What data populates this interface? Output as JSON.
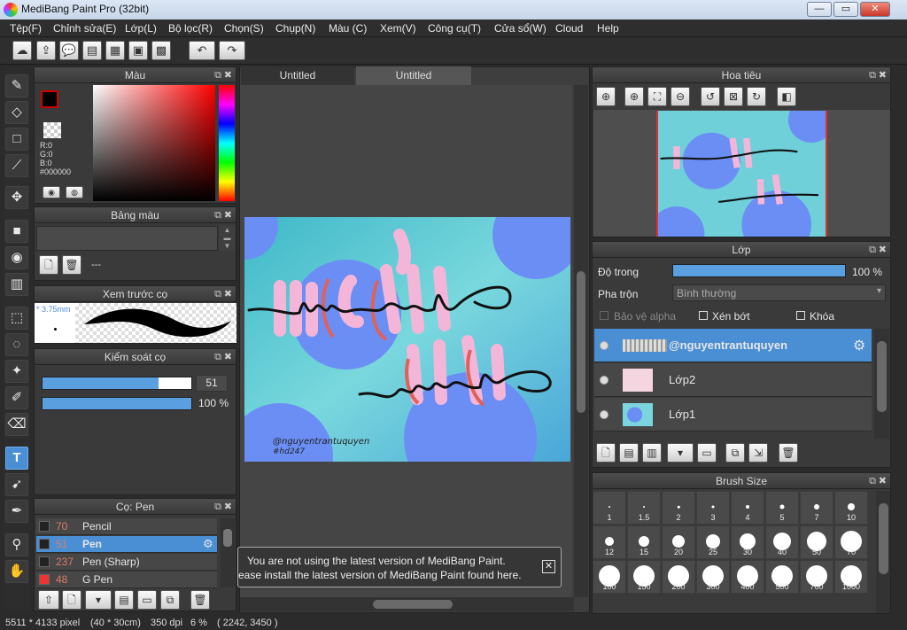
{
  "window": {
    "title": "MediBang Paint Pro (32bit)",
    "min": "—",
    "max": "▭",
    "close": "✕"
  },
  "menu": [
    "Tệp(F)",
    "Chỉnh sửa(E)",
    "Lớp(L)",
    "Bộ lọc(R)",
    "Chọn(S)",
    "Chụp(N)",
    "Màu (C)",
    "Xem(V)",
    "Công cụ(T)",
    "Cửa sổ(W)",
    "Cloud",
    "Help"
  ],
  "color_panel": {
    "title": "Màu",
    "r": "R:0",
    "g": "G:0",
    "b": "B:0",
    "hex": "#000000",
    "fg": "#000000",
    "accent": "#cc0000"
  },
  "palette_panel": {
    "title": "Bảng màu",
    "name": "---"
  },
  "brush_preview": {
    "title": "Xem trước cọ",
    "size": "3.75mm"
  },
  "brush_control": {
    "title": "Kiểm soát cọ",
    "size_value": "51",
    "opacity_value": "100 %",
    "size_fraction": 0.78,
    "opacity_fraction": 1.0
  },
  "brush_list": {
    "title": "Cọ: Pen",
    "items": [
      {
        "num": "70",
        "name": "Pencil",
        "sel": false
      },
      {
        "num": "51",
        "name": "Pen",
        "sel": true
      },
      {
        "num": "237",
        "name": "Pen (Sharp)",
        "sel": false
      },
      {
        "num": "48",
        "name": "G Pen",
        "sel": false
      }
    ]
  },
  "tabs": [
    "Untitled",
    "Untitled"
  ],
  "artwork": {
    "credit1": "@nguyentrantuquyen",
    "credit2": "#hd247"
  },
  "notice": {
    "line1": "You are not using the latest version of MediBang Paint.",
    "line2": "ease install the latest version of MediBang Paint found here."
  },
  "navigator": {
    "title": "Hoa tiêu"
  },
  "layers_panel": {
    "title": "Lớp",
    "opacity_label": "Độ trong",
    "opacity_value": "100 %",
    "opacity_fraction": 1.0,
    "blend_label": "Pha trộn",
    "blend_value": "Bình thường",
    "protect_alpha": "Bảo vệ alpha",
    "clipping": "Xén bớt",
    "lock": "Khóa",
    "layers": [
      {
        "name": "@nguyentrantuquyen",
        "sel": true
      },
      {
        "name": "Lớp2",
        "sel": false
      },
      {
        "name": "Lớp1",
        "sel": false
      }
    ]
  },
  "brush_size": {
    "title": "Brush Size",
    "sizes": [
      "1",
      "1.5",
      "2",
      "3",
      "4",
      "5",
      "7",
      "10",
      "12",
      "15",
      "20",
      "25",
      "30",
      "40",
      "50",
      "70",
      "100",
      "150",
      "200",
      "300",
      "400",
      "500",
      "700",
      "1000"
    ]
  },
  "status": {
    "dimensions": "5511 * 4133 pixel",
    "physical": "(40 * 30cm)",
    "dpi": "350 dpi",
    "zoom": "6 %",
    "coords": "( 2242, 3450 )"
  },
  "colors": {
    "accent": "#4a8fd4",
    "panel": "#3a3a3a",
    "bg": "#2b2b2b"
  }
}
